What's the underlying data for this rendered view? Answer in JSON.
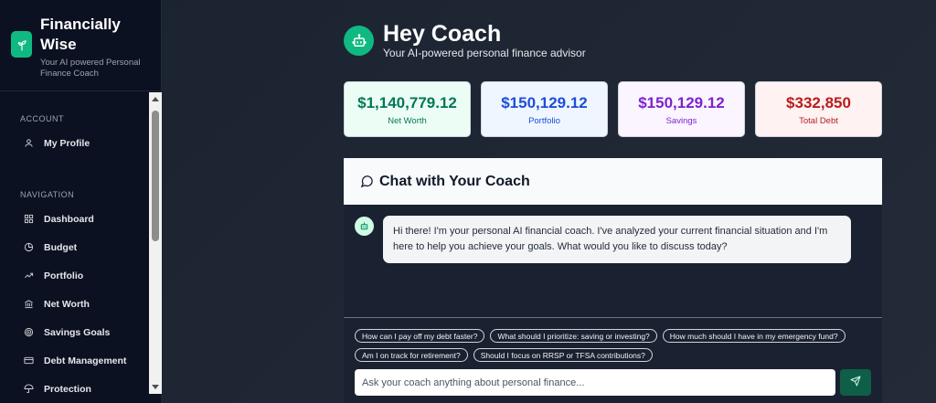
{
  "brand": {
    "title": "Financially Wise",
    "subtitle": "Your AI powered Personal Finance Coach"
  },
  "sidebar": {
    "account_label": "ACCOUNT",
    "account_items": [
      {
        "label": "My Profile",
        "icon": "user-icon"
      }
    ],
    "navigation_label": "NAVIGATION",
    "nav_items": [
      {
        "label": "Dashboard",
        "icon": "grid-icon"
      },
      {
        "label": "Budget",
        "icon": "pie-chart-icon"
      },
      {
        "label": "Portfolio",
        "icon": "trending-up-icon"
      },
      {
        "label": "Net Worth",
        "icon": "bank-icon"
      },
      {
        "label": "Savings Goals",
        "icon": "target-icon"
      },
      {
        "label": "Debt Management",
        "icon": "credit-card-icon"
      },
      {
        "label": "Protection",
        "icon": "umbrella-icon"
      }
    ]
  },
  "header": {
    "title": "Hey Coach",
    "subtitle": "Your AI-powered personal finance advisor"
  },
  "stats": [
    {
      "value": "$1,140,779.12",
      "label": "Net Worth",
      "bg": "#ecfdf5",
      "color": "#047857"
    },
    {
      "value": "$150,129.12",
      "label": "Portfolio",
      "bg": "#eff6ff",
      "color": "#1d4ed8"
    },
    {
      "value": "$150,129.12",
      "label": "Savings",
      "bg": "#faf5ff",
      "color": "#7e22ce"
    },
    {
      "value": "$332,850",
      "label": "Total Debt",
      "bg": "#fef2f2",
      "color": "#b91c1c"
    }
  ],
  "chat": {
    "title": "Chat with Your Coach",
    "message": "Hi there! I'm your personal AI financial coach. I've analyzed your current financial situation and I'm here to help you achieve your goals. What would you like to discuss today?",
    "suggestions_row1": [
      "How can I pay off my debt faster?",
      "What should I prioritize: saving or investing?",
      "How much should I have in my emergency fund?"
    ],
    "suggestions_row2": [
      "Am I on track for retirement?",
      "Should I focus on RRSP or TFSA contributions?"
    ],
    "input_placeholder": "Ask your coach anything about personal finance..."
  },
  "colors": {
    "accent": "#10b981",
    "sidebar_bg": "#0b1120",
    "send_button": "#0f5e48"
  }
}
